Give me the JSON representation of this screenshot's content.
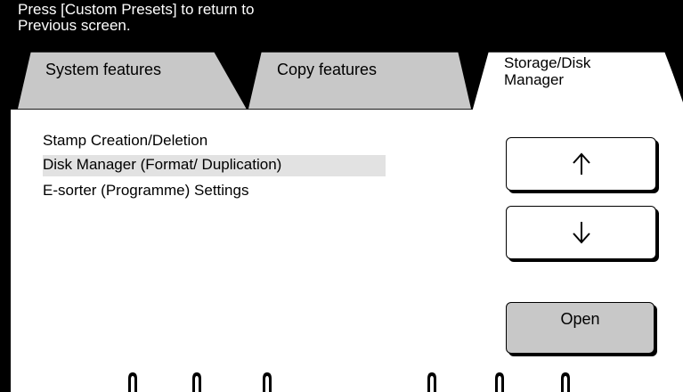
{
  "header": {
    "message_line1": "Press [Custom Presets] to return to",
    "message_line2": "Previous screen."
  },
  "tabs": [
    {
      "label": "System features"
    },
    {
      "label": "Copy features"
    },
    {
      "label_line1": "Storage/Disk",
      "label_line2": "Manager",
      "selected": true
    }
  ],
  "list": {
    "items": [
      {
        "label": "Stamp Creation/Deletion"
      },
      {
        "label": "Disk Manager (Format/ Duplication)",
        "highlighted": true
      },
      {
        "label": "E-sorter (Programme) Settings"
      }
    ]
  },
  "buttons": {
    "up_icon": "arrow-up-icon",
    "down_icon": "arrow-down-icon",
    "open_label": "Open"
  },
  "colors": {
    "background": "#000000",
    "panel": "#ffffff",
    "highlight": "#e2e2e2",
    "open_button": "#c8c8c8"
  }
}
